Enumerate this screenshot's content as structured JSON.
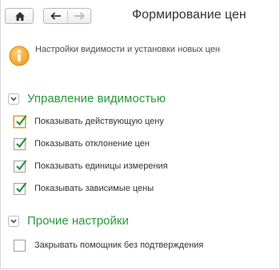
{
  "window": {
    "title": "Формирование цен"
  },
  "toolbar": {
    "home_icon": "home-icon",
    "back_icon": "arrow-left-icon",
    "forward_icon": "arrow-right-icon"
  },
  "info": {
    "text": "Настройки видимости и установки новых цен",
    "icon": "info-icon"
  },
  "groups": [
    {
      "title": "Управление видимостью",
      "items": [
        {
          "label": "Показывать действующую цену",
          "checked": true
        },
        {
          "label": "Показывать отклонение цен",
          "checked": true
        },
        {
          "label": "Показывать единицы измерения",
          "checked": true
        },
        {
          "label": "Показывать зависимые цены",
          "checked": true
        }
      ]
    },
    {
      "title": "Прочие настройки",
      "items": [
        {
          "label": "Закрывать помощник без подтверждения",
          "checked": false
        }
      ]
    }
  ],
  "colors": {
    "accent_green": "#269b3c",
    "info_orange": "#f2a22a",
    "focus": "#d9a430"
  }
}
